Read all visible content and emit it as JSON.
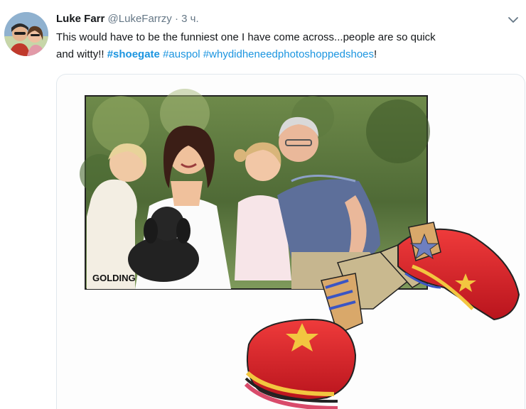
{
  "tweet": {
    "author_name": "Luke Farr",
    "author_handle": "@LukeFarrzy",
    "separator": "·",
    "time": "3 ч.",
    "text_line1": "This would have to be the funniest one I have come across...people are so quick",
    "text_line2_prefix": "and witty!! ",
    "hashtags": [
      "#shoegate",
      "#auspol",
      "#whydidheneedphotoshoppedshoes"
    ],
    "text_suffix": "!"
  },
  "media": {
    "signature": "GOLDING"
  },
  "icons": {
    "caret": "chevron-down-icon",
    "avatar": "avatar-photo"
  },
  "colors": {
    "hashtag": "#1b95e0",
    "secondary_text": "#657786",
    "primary_text": "#14171a"
  }
}
